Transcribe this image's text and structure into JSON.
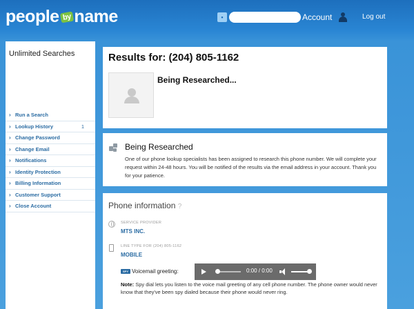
{
  "header": {
    "logo": {
      "part1": "people",
      "part2": "by",
      "part3": "name"
    },
    "account_label": "Account",
    "logout_label": "Log out"
  },
  "sidebar": {
    "title": "Unlimited Searches",
    "items": [
      {
        "label": "Run a Search",
        "count": ""
      },
      {
        "label": "Lookup History",
        "count": "1"
      },
      {
        "label": "Change Password",
        "count": ""
      },
      {
        "label": "Change Email",
        "count": ""
      },
      {
        "label": "Notifications",
        "count": ""
      },
      {
        "label": "Identity Protection",
        "count": ""
      },
      {
        "label": "Billing Information",
        "count": ""
      },
      {
        "label": "Customer Support",
        "count": ""
      },
      {
        "label": "Close Account",
        "count": ""
      }
    ]
  },
  "results": {
    "title": "Results for: (204) 805-1162",
    "status": "Being Researched..."
  },
  "researched": {
    "title": "Being Researched",
    "text": "One of our phone lookup specialists has been assigned to research this phone number. We will complete your request within 24-48 hours. You will be notified of the results via the email address in your account. Thank you for your patience."
  },
  "phone_info": {
    "title": "Phone information",
    "help": "?",
    "service_provider_label": "SERVICE PROVIDER",
    "service_provider_value": "MTS INC.",
    "line_type_label": "LINE TYPE FOR (204) 805-1162",
    "line_type_value": "MOBILE",
    "voicemail_badge": "SPY",
    "voicemail_label": "Voicemail greeting:",
    "player_time": "0:00 / 0:00",
    "note_bold": "Note:",
    "note_text": " Spy dial lets you listen to the voice mail greeting of any cell phone number. The phone owner would never know that they've been spy dialed because their phone would never ring."
  },
  "colors": {
    "header_blue": "#1d6fbd",
    "link_blue": "#2b6ca3",
    "logo_green": "#7cc242"
  }
}
